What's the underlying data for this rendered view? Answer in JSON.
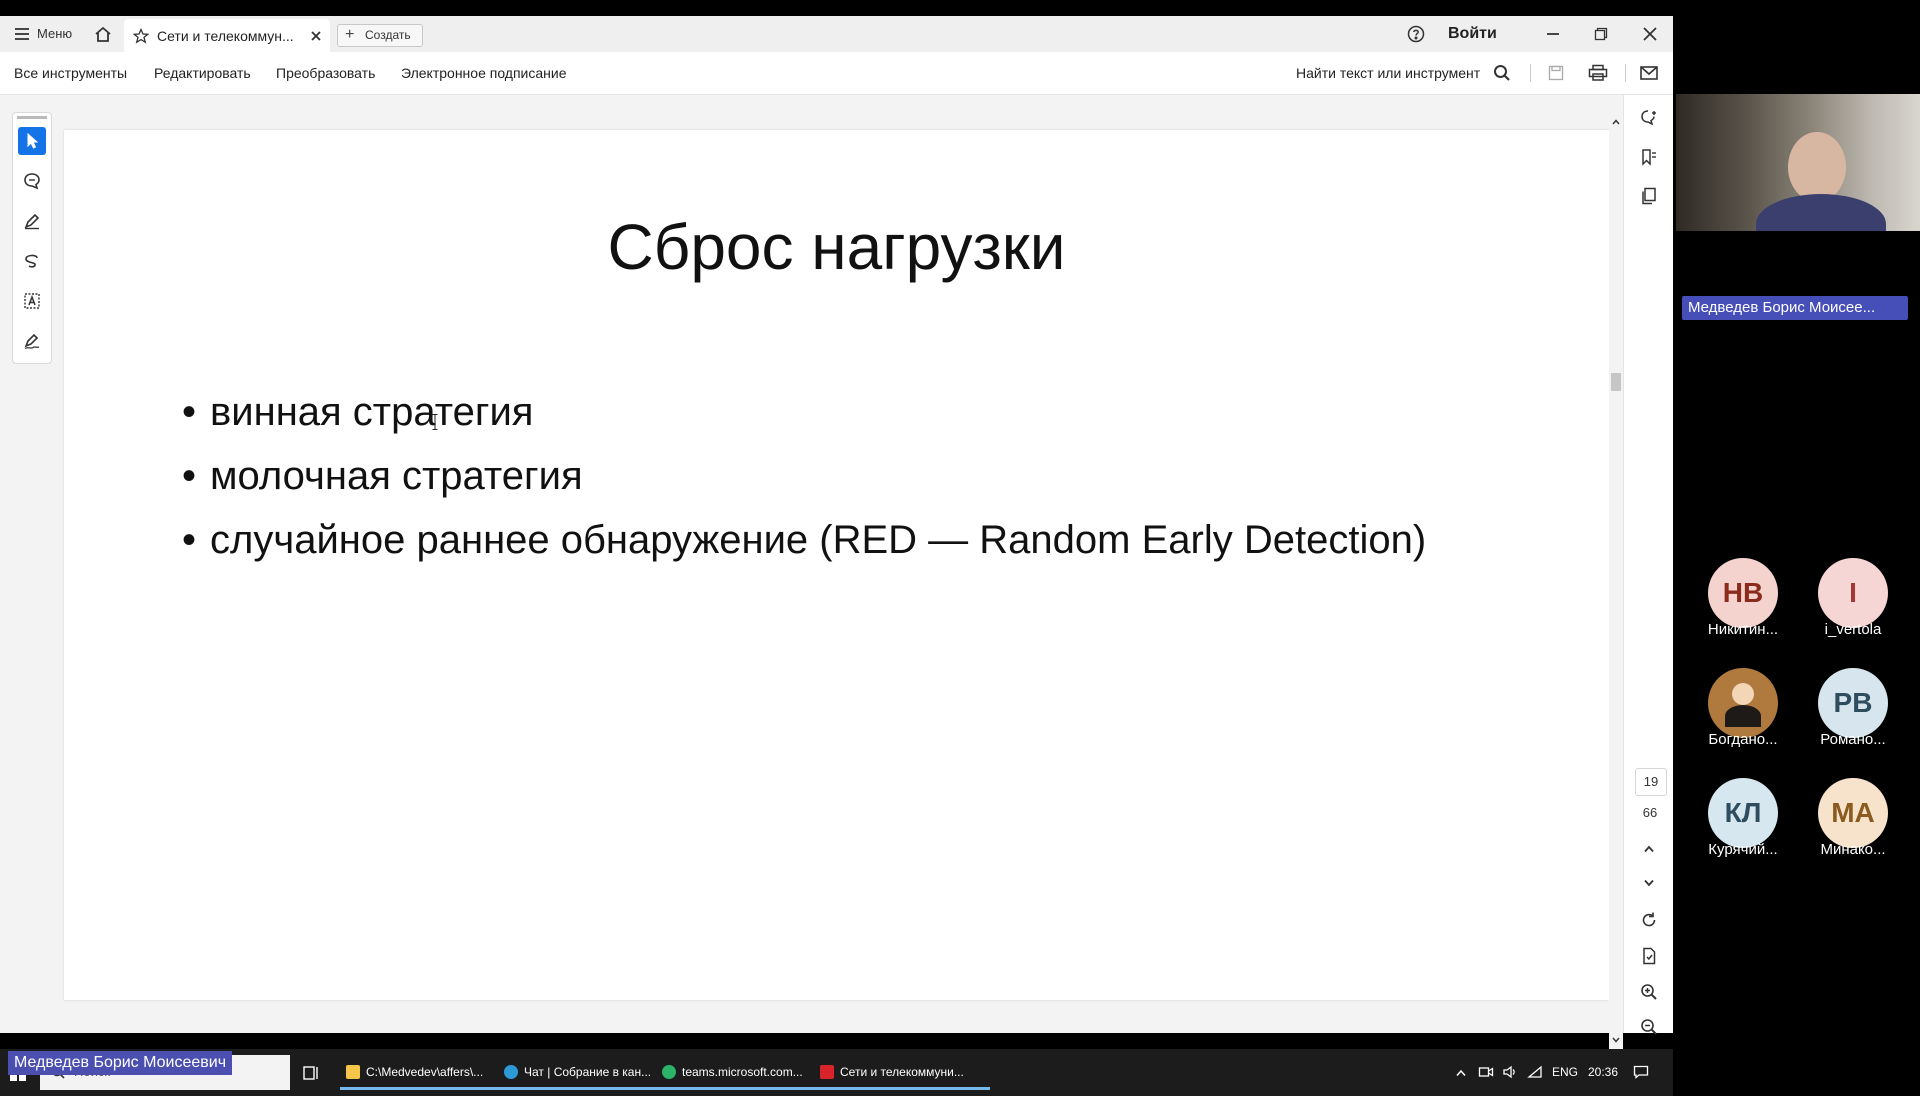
{
  "app": {
    "menu_label": "Меню",
    "tab_title": "Сети и телекоммун...",
    "create_label": "Создать",
    "login_label": "Войти",
    "toolbar": {
      "all_tools": "Все инструменты",
      "edit": "Редактировать",
      "convert": "Преобразовать",
      "esign": "Электронное подписание",
      "search": "Найти текст или инструмент"
    },
    "page_current": "19",
    "page_total": "66"
  },
  "slide": {
    "title": "Сброс нагрузки",
    "bullets": [
      "винная стратегия",
      "молочная стратегия",
      "случайное раннее обнаружение (RED — Random Early Detection)"
    ]
  },
  "taskbar": {
    "search_placeholder": "Поиск",
    "apps": [
      "C:\\Medvedev\\affers\\...",
      "Чат | Собрание в кан...",
      "teams.microsoft.com...",
      "Сети и телекоммуни..."
    ],
    "lang": "ENG",
    "time": "20:36"
  },
  "meeting": {
    "presenter_badge": "Медведев Борис Моисее...",
    "bottom_name": "Медведев Борис Моисеевич",
    "participants": [
      {
        "initials": "НВ",
        "name": "Никитин...",
        "color": "#f4d3cf",
        "fg": "#8a2b1e"
      },
      {
        "initials": "I",
        "name": "i_vertola",
        "color": "#f6d6d4",
        "fg": "#a33a31"
      },
      {
        "initials": "",
        "name": "Богдано...",
        "color": "#b07a3e",
        "fg": "#ffffff"
      },
      {
        "initials": "РВ",
        "name": "Романо...",
        "color": "#d7e6ee",
        "fg": "#2e4d5e"
      },
      {
        "initials": "КЛ",
        "name": "Курячий...",
        "color": "#d6e7ef",
        "fg": "#2e4d5e"
      },
      {
        "initials": "МА",
        "name": "Минако...",
        "color": "#f7e3cc",
        "fg": "#8a5a1e"
      }
    ]
  },
  "colors": {
    "accent": "#1473e6",
    "taskbar": "#1c1c1c",
    "presenter_badge": "#464eb8"
  }
}
